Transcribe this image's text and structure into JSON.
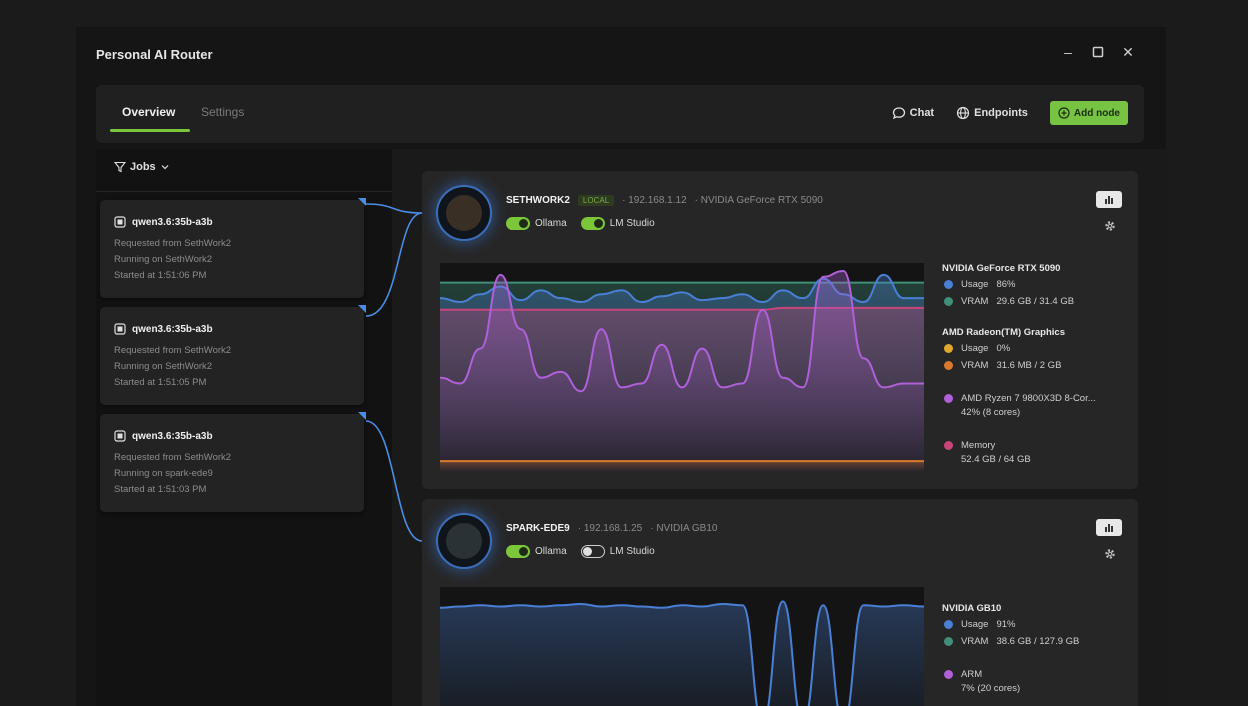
{
  "window": {
    "title": "Personal AI Router",
    "controls": {
      "minimize": "–",
      "close": "✕"
    }
  },
  "topbar": {
    "tabs": [
      {
        "label": "Overview",
        "active": true
      },
      {
        "label": "Settings",
        "active": false
      }
    ],
    "chat_label": "Chat",
    "endpoints_label": "Endpoints",
    "add_node_label": "Add node"
  },
  "jobs": {
    "filter_label": "Jobs",
    "items": [
      {
        "model": "qwen3.6:35b-a3b",
        "requested": "Requested from SethWork2",
        "running": "Running on SethWork2",
        "started": "Started at 1:51:06 PM"
      },
      {
        "model": "qwen3.6:35b-a3b",
        "requested": "Requested from SethWork2",
        "running": "Running on SethWork2",
        "started": "Started at 1:51:05 PM"
      },
      {
        "model": "qwen3.6:35b-a3b",
        "requested": "Requested from SethWork2",
        "running": "Running on spark-ede9",
        "started": "Started at 1:51:03 PM"
      }
    ]
  },
  "nodes": [
    {
      "name": "SETHWORK2",
      "badge": "LOCAL",
      "ip": "· 192.168.1.12",
      "gpu": "· NVIDIA GeForce RTX 5090",
      "toggles": [
        {
          "label": "Ollama",
          "on": true
        },
        {
          "label": "LM Studio",
          "on": true
        }
      ],
      "legend": [
        {
          "heading": "NVIDIA GeForce RTX 5090",
          "rows": [
            {
              "label": "Usage",
              "value": "86%",
              "color": "#4a7fd6"
            },
            {
              "label": "VRAM",
              "value": "29.6 GB / 31.4 GB",
              "color": "#3f8f7a"
            }
          ]
        },
        {
          "heading": "AMD Radeon(TM) Graphics",
          "rows": [
            {
              "label": "Usage",
              "value": "0%",
              "color": "#e0a92e"
            },
            {
              "label": "VRAM",
              "value": "31.6 MB / 2 GB",
              "color": "#d9782f"
            }
          ]
        },
        {
          "heading": "",
          "rows": [
            {
              "label": "AMD Ryzen 7 9800X3D 8-Cor...",
              "value": "",
              "sub": "42% (8 cores)",
              "color": "#b060d8"
            }
          ]
        },
        {
          "heading": "",
          "rows": [
            {
              "label": "Memory",
              "value": "",
              "sub": "52.4 GB / 64 GB",
              "color": "#c8457a"
            }
          ]
        }
      ],
      "chart_data": {
        "type": "area",
        "series": [
          {
            "name": "VRAM",
            "color": "#3f8f7a",
            "values": [
              94,
              94,
              94,
              94,
              94,
              94,
              94,
              94,
              94,
              94,
              94,
              94,
              94,
              94,
              94,
              94,
              94,
              94,
              94,
              94,
              94,
              94,
              94,
              94,
              94
            ]
          },
          {
            "name": "Usage",
            "color": "#4a7fd6",
            "values": [
              86,
              84,
              88,
              92,
              85,
              90,
              86,
              84,
              88,
              90,
              84,
              87,
              89,
              85,
              86,
              88,
              84,
              90,
              86,
              96,
              88,
              84,
              98,
              86,
              86
            ]
          },
          {
            "name": "Memory",
            "color": "#c8457a",
            "values": [
              80,
              80,
              80,
              80,
              80,
              80,
              80,
              80,
              80,
              80,
              80,
              80,
              80,
              80,
              80,
              80,
              80,
              81,
              81,
              81,
              81,
              81,
              81,
              81,
              81
            ]
          },
          {
            "name": "AMD Ryzen 7 9800X3D 8-Cor...",
            "color": "#b060d8",
            "values": [
              45,
              42,
              60,
              98,
              70,
              45,
              48,
              38,
              70,
              40,
              42,
              62,
              40,
              60,
              40,
              42,
              80,
              45,
              40,
              97,
              100,
              55,
              40,
              42,
              42
            ]
          },
          {
            "name": "AMD Radeon(TM) Graphics VRAM",
            "color": "#d9782f",
            "values": [
              2,
              2,
              2,
              2,
              2,
              2,
              2,
              2,
              2,
              2,
              2,
              2,
              2,
              2,
              2,
              2,
              2,
              2,
              2,
              2,
              2,
              2,
              2,
              2,
              2
            ]
          }
        ]
      }
    },
    {
      "name": "SPARK-EDE9",
      "badge": "",
      "ip": "· 192.168.1.25",
      "gpu": "· NVIDIA GB10",
      "toggles": [
        {
          "label": "Ollama",
          "on": true
        },
        {
          "label": "LM Studio",
          "on": false
        }
      ],
      "legend": [
        {
          "heading": "NVIDIA GB10",
          "rows": [
            {
              "label": "Usage",
              "value": "91%",
              "color": "#4a7fd6"
            },
            {
              "label": "VRAM",
              "value": "38.6 GB / 127.9 GB",
              "color": "#3f8f7a"
            }
          ]
        },
        {
          "heading": "",
          "rows": [
            {
              "label": "ARM",
              "value": "",
              "sub": "7% (20 cores)",
              "color": "#b060d8"
            }
          ]
        }
      ],
      "chart_data": {
        "type": "area",
        "series": [
          {
            "name": "Usage",
            "color": "#4a7fd6",
            "values": [
              90,
              91,
              92,
              91,
              92,
              91,
              92,
              93,
              91,
              92,
              91,
              90,
              92,
              91,
              93,
              92,
              0,
              95,
              0,
              92,
              0,
              92,
              91,
              92,
              91
            ]
          }
        ]
      }
    }
  ]
}
